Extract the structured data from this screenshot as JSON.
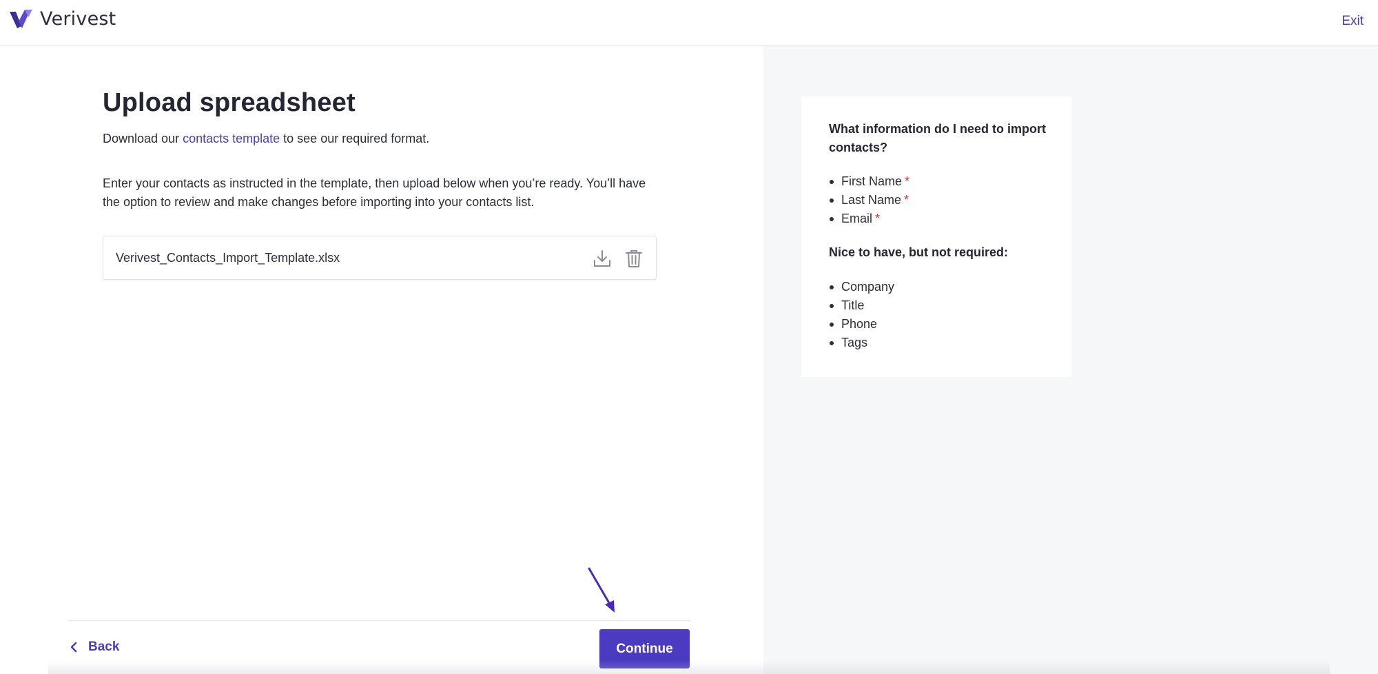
{
  "header": {
    "brand": "Verivest",
    "exit_label": "Exit"
  },
  "main": {
    "title": "Upload spreadsheet",
    "intro_prefix": "Download our ",
    "intro_link": "contacts template",
    "intro_suffix": " to see our required format.",
    "instructions": "Enter your contacts as instructed in the template, then upload below when you’re ready. You’ll have the option to review and make changes before importing into your contacts list.",
    "file_name": "Verivest_Contacts_Import_Template.xlsx"
  },
  "footer": {
    "back_label": "Back",
    "continue_label": "Continue"
  },
  "info": {
    "title": "What information do I need to import contacts?",
    "required_items": [
      {
        "label": "First Name",
        "marker": "*"
      },
      {
        "label": "Last Name",
        "marker": "*"
      },
      {
        "label": "Email",
        "marker": "*"
      }
    ],
    "optional_title": "Nice to have, but not required:",
    "optional_items": [
      "Company",
      "Title",
      "Phone",
      "Tags"
    ]
  },
  "colors": {
    "accent": "#4a3bc1",
    "required_marker": "#e03131",
    "panel_bg": "#f6f7f9"
  },
  "icons": {
    "logo": "verivest-v-logo-icon",
    "download": "download-icon",
    "delete": "trash-icon",
    "back": "chevron-left-icon",
    "annotation": "arrow-pointer-icon"
  }
}
